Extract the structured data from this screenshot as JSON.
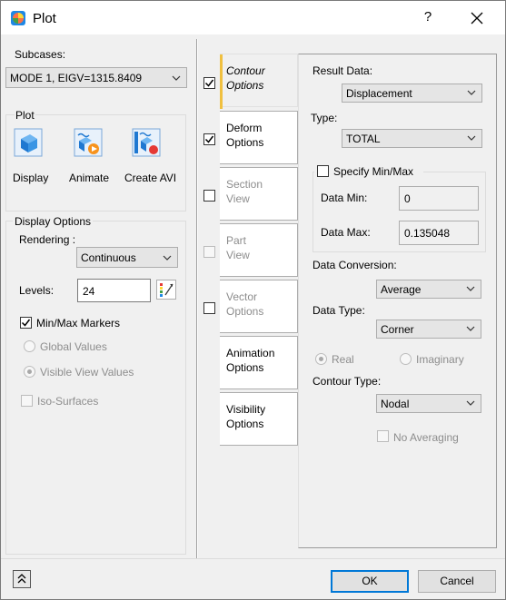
{
  "window": {
    "title": "Plot",
    "help_label": "?",
    "icons": {
      "app": "plot-app-icon",
      "close": "close-icon"
    }
  },
  "subcases": {
    "label": "Subcases:",
    "selected": "MODE 1, EIGV=1315.8409"
  },
  "plot": {
    "label": "Plot",
    "buttons": [
      {
        "label": "Display",
        "icon": "display-icon"
      },
      {
        "label": "Animate",
        "icon": "animate-icon"
      },
      {
        "label": "Create AVI",
        "icon": "create-avi-icon"
      }
    ]
  },
  "display_options": {
    "label": "Display Options",
    "rendering_label": "Rendering :",
    "rendering_value": "Continuous",
    "levels_label": "Levels:",
    "levels_value": "24",
    "minmax_label": "Min/Max Markers",
    "minmax_checked": true,
    "global_values_label": "Global Values",
    "visible_view_values_label": "Visible View Values",
    "iso_surfaces_label": "Iso-Surfaces"
  },
  "tabs": [
    {
      "label": "Contour Options",
      "checked": true,
      "active": true,
      "enabled": true
    },
    {
      "label": "Deform Options",
      "checked": true,
      "active": false,
      "enabled": true
    },
    {
      "label": "Section View",
      "checked": false,
      "active": false,
      "enabled": false
    },
    {
      "label": "Part View",
      "checked": false,
      "active": false,
      "enabled": false
    },
    {
      "label": "Vector Options",
      "checked": false,
      "active": false,
      "enabled": false
    },
    {
      "label": "Animation Options",
      "active": false,
      "enabled": true
    },
    {
      "label": "Visibility Options",
      "active": false,
      "enabled": true
    }
  ],
  "contour": {
    "result_data_label": "Result Data:",
    "result_data_value": "Displacement",
    "type_label": "Type:",
    "type_value": "TOTAL",
    "specify_minmax_label": "Specify Min/Max",
    "data_min_label": "Data Min:",
    "data_min_value": "0",
    "data_max_label": "Data Max:",
    "data_max_value": "0.135048",
    "data_conversion_label": "Data Conversion:",
    "data_conversion_value": "Average",
    "data_type_label": "Data Type:",
    "data_type_value": "Corner",
    "real_label": "Real",
    "imaginary_label": "Imaginary",
    "contour_type_label": "Contour Type:",
    "contour_type_value": "Nodal",
    "no_averaging_label": "No Averaging"
  },
  "footer": {
    "collapse_icon": "double-chevron-up-icon",
    "ok_label": "OK",
    "cancel_label": "Cancel"
  },
  "colors": {
    "accent": "#0078d7",
    "active_tab_marker": "#f0c040"
  }
}
